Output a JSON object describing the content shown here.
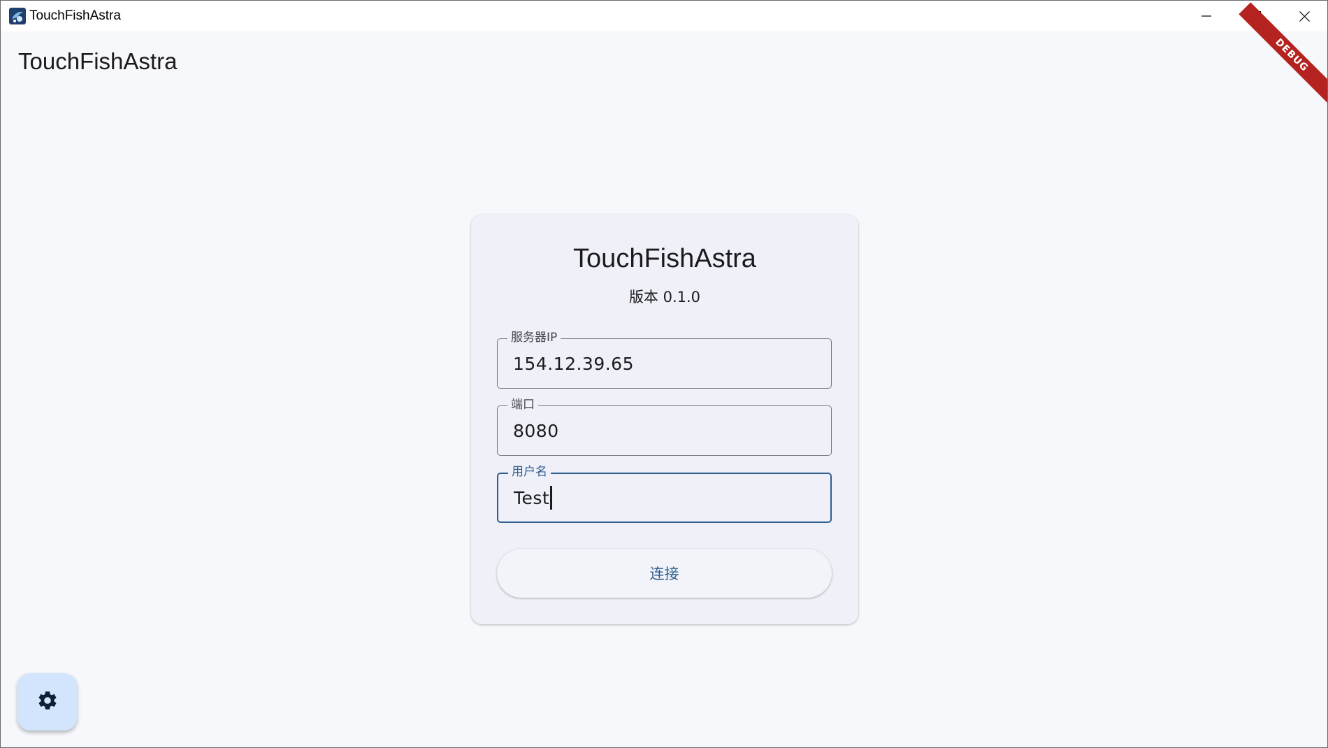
{
  "window": {
    "title": "TouchFishAstra",
    "icon": "app-icon",
    "controls": [
      "minimize-icon",
      "maximize-icon",
      "close-icon"
    ]
  },
  "appbar": {
    "title": "TouchFishAstra"
  },
  "debug_banner": "DEBUG",
  "card": {
    "title": "TouchFishAstra",
    "version": "版本 0.1.0",
    "fields": {
      "server_ip": {
        "label": "服务器IP",
        "value": "154.12.39.65"
      },
      "port": {
        "label": "端口",
        "value": "8080"
      },
      "username": {
        "label": "用户名",
        "value": "Test",
        "focused": true
      }
    },
    "connect_label": "连接"
  },
  "fab": {
    "icon": "gear-icon"
  },
  "colors": {
    "background": "#f7f8fc",
    "card": "#f0f1f8",
    "accent": "#2f5f8f",
    "fab": "#d3e4fd",
    "debug": "#b4231f"
  }
}
